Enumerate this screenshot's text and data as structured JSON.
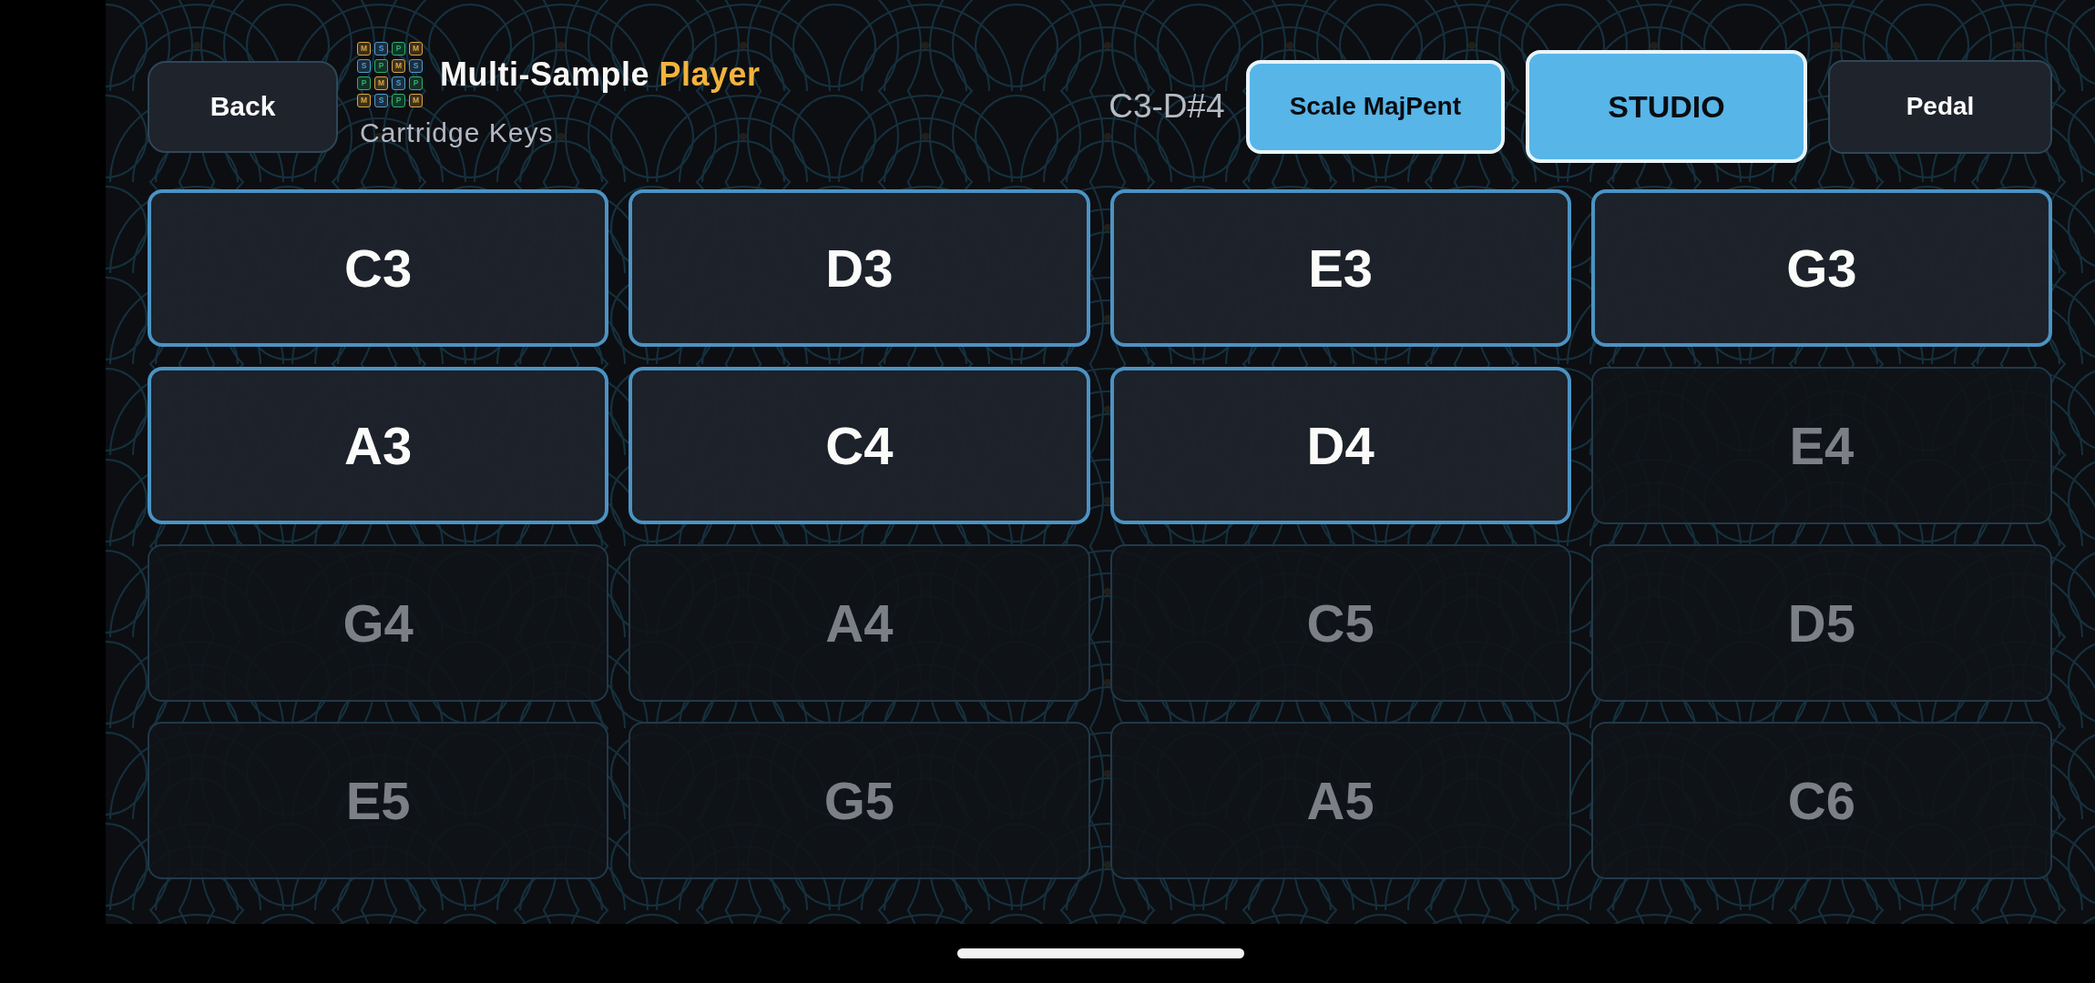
{
  "header": {
    "back_button": {
      "label": "Back"
    },
    "logo": {
      "tiles": [
        {
          "letter": "M",
          "color": "#d9a53f"
        },
        {
          "letter": "S",
          "color": "#4f9bd0"
        },
        {
          "letter": "P",
          "color": "#2fae6e"
        },
        {
          "letter": "M",
          "color": "#d9a53f"
        },
        {
          "letter": "S",
          "color": "#4f9bd0"
        },
        {
          "letter": "P",
          "color": "#2fae6e"
        },
        {
          "letter": "M",
          "color": "#d9a53f"
        },
        {
          "letter": "S",
          "color": "#4f9bd0"
        },
        {
          "letter": "P",
          "color": "#2fae6e"
        },
        {
          "letter": "M",
          "color": "#d9a53f"
        },
        {
          "letter": "S",
          "color": "#4f9bd0"
        },
        {
          "letter": "P",
          "color": "#2fae6e"
        },
        {
          "letter": "M",
          "color": "#d9a53f"
        },
        {
          "letter": "S",
          "color": "#4f9bd0"
        },
        {
          "letter": "P",
          "color": "#2fae6e"
        },
        {
          "letter": "M",
          "color": "#d9a53f"
        }
      ]
    },
    "title": {
      "text": "Multi-Sample",
      "highlight": "Player"
    },
    "subtitle": "Cartridge Keys",
    "range": "C3-D#4",
    "buttons": [
      {
        "label": "Scale MajPent",
        "kind": "toggle",
        "selected": true
      },
      {
        "label": "STUDIO",
        "kind": "preset",
        "selected": true
      },
      {
        "label": "Pedal",
        "kind": "toggle",
        "selected": false
      }
    ]
  },
  "pads": [
    {
      "label": "C3",
      "active": true
    },
    {
      "label": "D3",
      "active": true
    },
    {
      "label": "E3",
      "active": true
    },
    {
      "label": "G3",
      "active": true
    },
    {
      "label": "A3",
      "active": true
    },
    {
      "label": "C4",
      "active": true
    },
    {
      "label": "D4",
      "active": true
    },
    {
      "label": "E4",
      "active": false
    },
    {
      "label": "G4",
      "active": false
    },
    {
      "label": "A4",
      "active": false
    },
    {
      "label": "C5",
      "active": false
    },
    {
      "label": "D5",
      "active": false
    },
    {
      "label": "E5",
      "active": false
    },
    {
      "label": "G5",
      "active": false
    },
    {
      "label": "A5",
      "active": false
    },
    {
      "label": "C6",
      "active": false
    }
  ]
}
